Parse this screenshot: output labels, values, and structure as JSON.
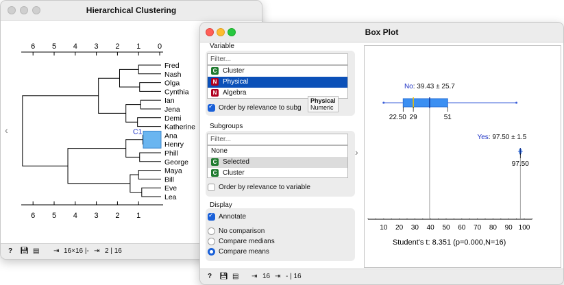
{
  "hc": {
    "title": "Hierarchical Clustering",
    "axis_top": [
      "6",
      "5",
      "4",
      "3",
      "2",
      "1",
      "0"
    ],
    "axis_bottom": [
      "6",
      "5",
      "4",
      "3",
      "2",
      "1"
    ],
    "labels": [
      "Fred",
      "Nash",
      "Olga",
      "Cynthia",
      "Ian",
      "Jena",
      "Demi",
      "Katherine",
      "Ana",
      "Henry",
      "Phill",
      "George",
      "Maya",
      "Bill",
      "Eve",
      "Lea"
    ],
    "cluster_label": "C1",
    "status": {
      "input": "16×16 |-",
      "output": "2 | 16"
    }
  },
  "bp": {
    "title": "Box Plot",
    "variable": {
      "header": "Variable",
      "filter_placeholder": "Filter...",
      "items": [
        {
          "tag": "C",
          "label": "Cluster",
          "color": "#1e7a2e",
          "selected": false
        },
        {
          "tag": "N",
          "label": "Physical",
          "color": "#b00020",
          "selected": true
        },
        {
          "tag": "N",
          "label": "Algebra",
          "color": "#b00020",
          "selected": false
        }
      ],
      "order_label": "Order by relevance to subg",
      "tooltip": {
        "title": "Physical",
        "sub": "Numeric"
      }
    },
    "subgroups": {
      "header": "Subgroups",
      "filter_placeholder": "Filter...",
      "none_label": "None",
      "items": [
        {
          "tag": "C",
          "label": "Selected",
          "color": "#1e7a2e",
          "selected": true
        },
        {
          "tag": "C",
          "label": "Cluster",
          "color": "#1e7a2e",
          "selected": false
        }
      ],
      "order_label": "Order by relevance to variable"
    },
    "display": {
      "header": "Display",
      "annotate": "Annotate",
      "options": [
        "No comparison",
        "Compare medians",
        "Compare means"
      ],
      "selected": "Compare means"
    },
    "status": {
      "input": "16",
      "output": "- | 16"
    }
  },
  "chart_data": {
    "type": "box",
    "axis_ticks": [
      10,
      20,
      30,
      40,
      50,
      60,
      70,
      80,
      90,
      100
    ],
    "xlim": [
      0,
      105
    ],
    "groups": [
      {
        "name": "No",
        "label": "No",
        "stat_text": ": 39.43 ± 25.7",
        "min": 10,
        "q1": 22.5,
        "median": 29,
        "mean": 39.43,
        "q3": 51,
        "max": 95,
        "tick_labels": [
          "22.50",
          "29",
          "51"
        ]
      },
      {
        "name": "Yes",
        "label": "Yes",
        "stat_text": ": 97.50 ± 1.5",
        "min": 96,
        "q1": 97,
        "median": 97.5,
        "mean": 97.5,
        "q3": 98,
        "max": 99,
        "tick_labels": [
          "97.50"
        ]
      }
    ],
    "caption": "Student's t: 8.351 (p=0.000,N=16)"
  },
  "colors": {
    "accent": "#1a60d8",
    "box": "#3b8ff2",
    "highlight": "#0b50b8",
    "cluster": "#6ab5f0",
    "label_blue": "#1a2fc4"
  }
}
